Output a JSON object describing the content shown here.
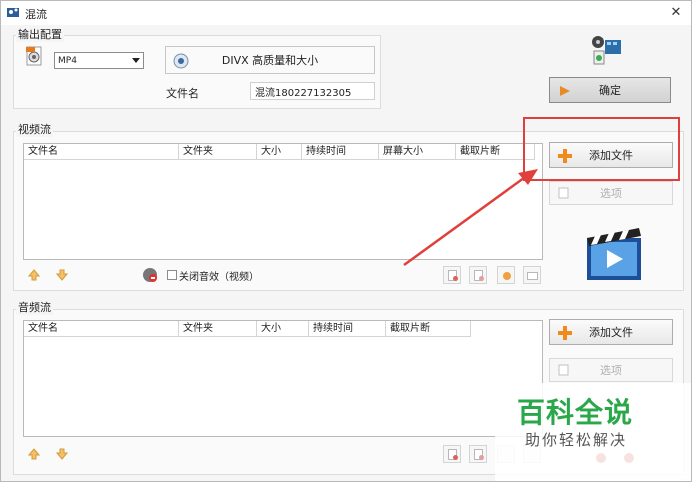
{
  "window": {
    "title": "混流"
  },
  "output_config": {
    "group_label": "输出配置",
    "format_value": "MP4",
    "preset_label": "DIVX 高质量和大小",
    "filename_label": "文件名",
    "filename_value": "混流180227132305"
  },
  "confirm_label": "确定",
  "video_stream": {
    "group_label": "视频流",
    "columns": [
      "文件名",
      "文件夹",
      "大小",
      "持续时间",
      "屏幕大小",
      "截取片断"
    ],
    "add_file_label": "添加文件",
    "options_label": "选项",
    "mute_label": "关闭音效（视频）"
  },
  "audio_stream": {
    "group_label": "音频流",
    "columns": [
      "文件名",
      "文件夹",
      "大小",
      "持续时间",
      "截取片断"
    ],
    "add_file_label": "添加文件",
    "options_label": "选项"
  },
  "watermark": {
    "main": "百科全说",
    "sub": "助你轻松解决"
  },
  "colors": {
    "highlight": "#e0403c",
    "watermark_green": "#2aa748",
    "plus_orange": "#f08a1c"
  }
}
